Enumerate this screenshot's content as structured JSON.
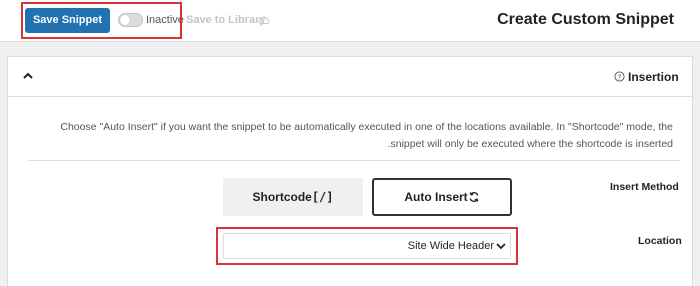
{
  "toolbar": {
    "save_label": "Save Snippet",
    "toggle_label": "Inactive",
    "save_library_label": "Save to Library",
    "toggle_state": "off"
  },
  "page": {
    "title": "Create Custom Snippet"
  },
  "panel": {
    "title": "Insertion",
    "description": "Choose \"Auto Insert\" if you want the snippet to be automatically executed in one of the locations available. In \"Shortcode\" mode, the snippet will only be executed where the shortcode is inserted.",
    "insert_method": {
      "label": "Insert Method",
      "options": [
        {
          "label": "Shortcode",
          "icon": "brackets-icon",
          "selected": false
        },
        {
          "label": "Auto Insert",
          "icon": "sync-icon",
          "selected": true
        }
      ]
    },
    "location": {
      "label": "Location",
      "selected": "Site Wide Header"
    }
  },
  "colors": {
    "primary": "#2271b1",
    "highlight": "#d63638",
    "text": "#1d2327",
    "muted": "#50575e",
    "disabled": "#c3c4c7"
  }
}
